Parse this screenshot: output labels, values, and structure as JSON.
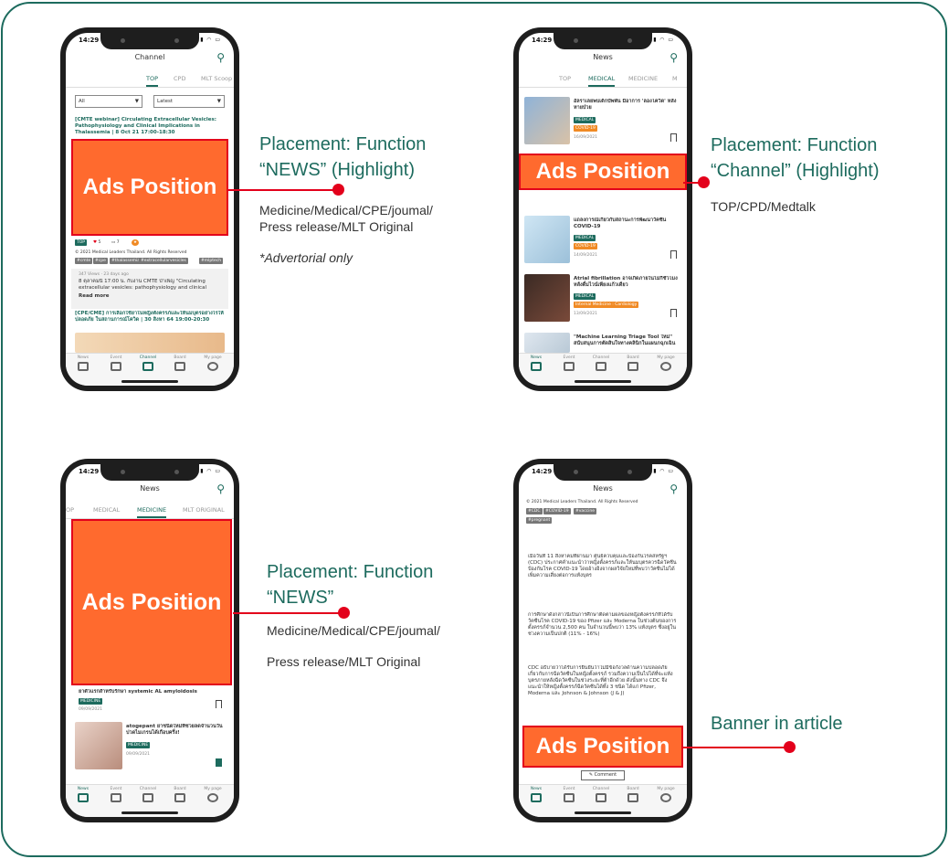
{
  "status_time": "14:29",
  "phone1": {
    "header": "Channel",
    "tabs": [
      "TOP",
      "CPD",
      "MLT Scoop"
    ],
    "filter_all": "All",
    "filter_latest": "Latest",
    "headline": "[CMTE webinar] Circulating Extracellular Vesicles: Pathophysiology and Clinical Implications in Thalassemia | 8 Oct 21 17:00-18:30",
    "ads": "Ads Position",
    "tag_top": "TOP",
    "like_count": "5",
    "comment_count": "7",
    "copyright": "© 2021 Medical Leaders Thailand. All Rights Reserved",
    "hashtags": [
      "#cmte",
      "#cpe",
      "#thalassemia",
      "#extracellularvesicles",
      "#mlptech"
    ],
    "meta": "347 Views · 23 days ago",
    "snippet": "8 ตุลาคมนี้ 17:00 น. กับงาน CMTE บำเพ็ญ \"Circulating extracellular vesicles: pathophysiology and clinical implica...",
    "read_more": "Read more",
    "headline2": "[CPE/CME] การเลือกใช้ยาในหญิงตั้งครรภ์และให้นมบุตรอย่างไรให้ปลอดภัย ในสถานการณ์โควิด | 30 สิงหา 64 19:00-20:30"
  },
  "phone2": {
    "header": "News",
    "tabs": [
      "TOP",
      "MEDICAL",
      "MEDICINE",
      "M"
    ],
    "items": [
      {
        "title": "อัลราเลยพบเด็กบัพพัน มีอาการ 'ลองโควิด' หลังหายป่วย",
        "tag1": "MEDICAL",
        "tag2": "COVID-19",
        "date": "16/09/2021"
      },
      {
        "title": "แถลงการณ์เกี่ยวกับสถานะการพัฒนาวัคซีน COVID-19",
        "tag1": "MEDICAL",
        "tag2": "COVID-19",
        "date": "14/09/2021"
      },
      {
        "title": "Atrial fibrillation อาจเกิดภายในไม่กี่ชั่วโมงหลังดื่มไวน์เพียงแก้วเดียว",
        "tag1": "MEDICAL",
        "tag2": "Internal Medicine : Cardiology",
        "date": "13/09/2021"
      },
      {
        "title": "\"Machine Learning Triage Tool ใหม่\" สนับสนุนการตัดสินใจทางคลินิกในแผนกฉุกเฉิน",
        "tag1": "",
        "tag2": "",
        "date": ""
      }
    ],
    "ads": "Ads Position"
  },
  "phone3": {
    "header": "News",
    "tabs": [
      "TOP",
      "MEDICAL",
      "MEDICINE",
      "MLT ORIGINAL"
    ],
    "ads": "Ads Position",
    "item1_title": "ยาตัวแรกสำหรับรักษา systemic AL amyloidosis",
    "item1_tag": "MEDICINE",
    "item1_date": "09/09/2021",
    "item2_title": "atogepant ยาชนิดใหม่ที่ช่วยลดจำนวนวันปวดไมเกรนได้เกือบครึ่ง!",
    "item2_tag": "MEDICINE",
    "item2_date": "09/09/2021"
  },
  "phone4": {
    "header": "News",
    "copyright": "© 2021 Medical Leaders Thailand. All Rights Reserved",
    "hashtags": [
      "#CDC",
      "#COVID-19",
      "#vaccine",
      "#pregnant"
    ],
    "para1": "เมื่อวันที่ 11 สิงหาคมที่ผ่านมา ศูนย์ควบคุมและป้องกันโรคสหรัฐฯ (CDC) ประกาศคำแนะนำว่าหญิงตั้งครรภ์และให้นมบุตรควรฉีดวัคซีนป้องกันโรค COVID-19 โดยอ้างอิงจากผลวิจัยใหม่ที่พบว่าวัคซีนไม่ได้เพิ่มความเสี่ยงต่อการแท้งบุตร",
    "para2": "การศึกษาดังกล่าวนี้เป็นการศึกษาติดตามผลของหญิงตั้งครรภ์ที่ได้รับวัคซีนโรค COVID-19 ของ Pfizer และ Moderna ในช่วงต้นของการตั้งครรภ์จำนวน 2,500 คน ในจำนวนนี้พบว่า 13% แท้งบุตร ซึ่งอยู่ในช่วงความเป็นปกติ (11% - 16%)",
    "para3": "CDC อธิบายว่าได้รับการยืนยันว่าไม่มีข้อกังวลด้านความปลอดภัยเกี่ยวกับการฉีดวัคซีนในหญิงตั้งครรภ์ รวมถึงความเป็นไปได้ที่จะแท้งบุตรภายหลังฉีดวัคซีนในช่วงระยะที่ต้าอีกด้วย ดังนั้นทาง CDC จึงแนะนำให้หญิงตั้งครรภ์ฉีดวัคซีนได้ทั้ง 3 ชนิด ได้แก่ Pfizer, Moderna และ Johnson & Johnson (J & J)",
    "ads": "Ads Position",
    "comment_btn": "Comment"
  },
  "nav_labels": [
    "News",
    "Event",
    "Channel",
    "Board",
    "My page"
  ],
  "callouts": {
    "c1_title1": "Placement: Function",
    "c1_title2": "“NEWS” (Highlight)",
    "c1_sub1": "Medicine/Medical/CPE/joumal/",
    "c1_sub2": "Press release/MLT Original",
    "c1_note": "*Advertorial only",
    "c2_title1": "Placement: Function",
    "c2_title2": "“Channel” (Highlight)",
    "c2_sub1": "TOP/CPD/Medtalk",
    "c3_title1": "Placement: Function",
    "c3_title2": "“NEWS”",
    "c3_sub1": "Medicine/Medical/CPE/joumal/",
    "c3_sub2": "Press release/MLT Original",
    "c4_title1": "Banner in article"
  },
  "colors": {
    "brand_teal": "#1d6b5e",
    "ads_orange": "#ff6a2e",
    "highlight_red": "#e3001b"
  }
}
